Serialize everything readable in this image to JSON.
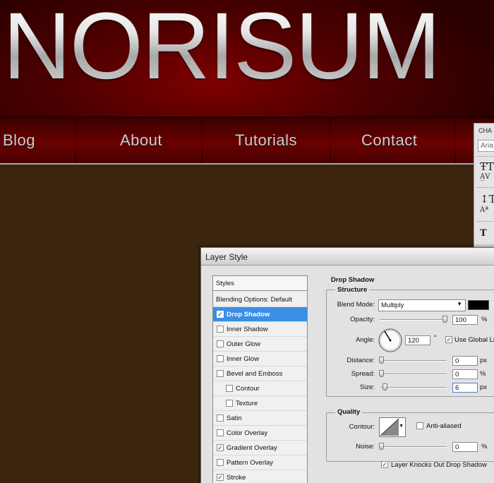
{
  "site": {
    "logo": "NORISUM",
    "nav": [
      "Blog",
      "About",
      "Tutorials",
      "Contact"
    ]
  },
  "character_panel": {
    "title": "CHA",
    "font_field": "Aria"
  },
  "dialog": {
    "title": "Layer Style",
    "styles_header": "Styles",
    "blending_options": "Blending Options: Default",
    "styles": [
      {
        "label": "Drop Shadow",
        "checked": true,
        "selected": true
      },
      {
        "label": "Inner Shadow",
        "checked": false
      },
      {
        "label": "Outer Glow",
        "checked": false
      },
      {
        "label": "Inner Glow",
        "checked": false
      },
      {
        "label": "Bevel and Emboss",
        "checked": false
      },
      {
        "label": "Contour",
        "checked": false,
        "indent": true
      },
      {
        "label": "Texture",
        "checked": false,
        "indent": true
      },
      {
        "label": "Satin",
        "checked": false
      },
      {
        "label": "Color Overlay",
        "checked": false
      },
      {
        "label": "Gradient Overlay",
        "checked": true
      },
      {
        "label": "Pattern Overlay",
        "checked": false
      },
      {
        "label": "Stroke",
        "checked": true
      }
    ],
    "panel": {
      "section": "Drop Shadow",
      "structure": "Structure",
      "blend_mode_label": "Blend Mode:",
      "blend_mode_value": "Multiply",
      "blend_color": "#000000",
      "opacity_label": "Opacity:",
      "opacity_value": "100",
      "opacity_unit": "%",
      "angle_label": "Angle:",
      "angle_value": "120",
      "angle_unit": "°",
      "global_light_label": "Use Global Li",
      "global_light_checked": true,
      "distance_label": "Distance:",
      "distance_value": "0",
      "distance_unit": "px",
      "spread_label": "Spread:",
      "spread_value": "0",
      "spread_unit": "%",
      "size_label": "Size:",
      "size_value": "6",
      "size_unit": "px",
      "quality": "Quality",
      "contour_label": "Contour:",
      "anti_aliased_label": "Anti-aliased",
      "anti_aliased_checked": false,
      "noise_label": "Noise:",
      "noise_value": "0",
      "noise_unit": "%",
      "knockout_label": "Layer Knocks Out Drop Shadow",
      "knockout_checked": true
    }
  }
}
